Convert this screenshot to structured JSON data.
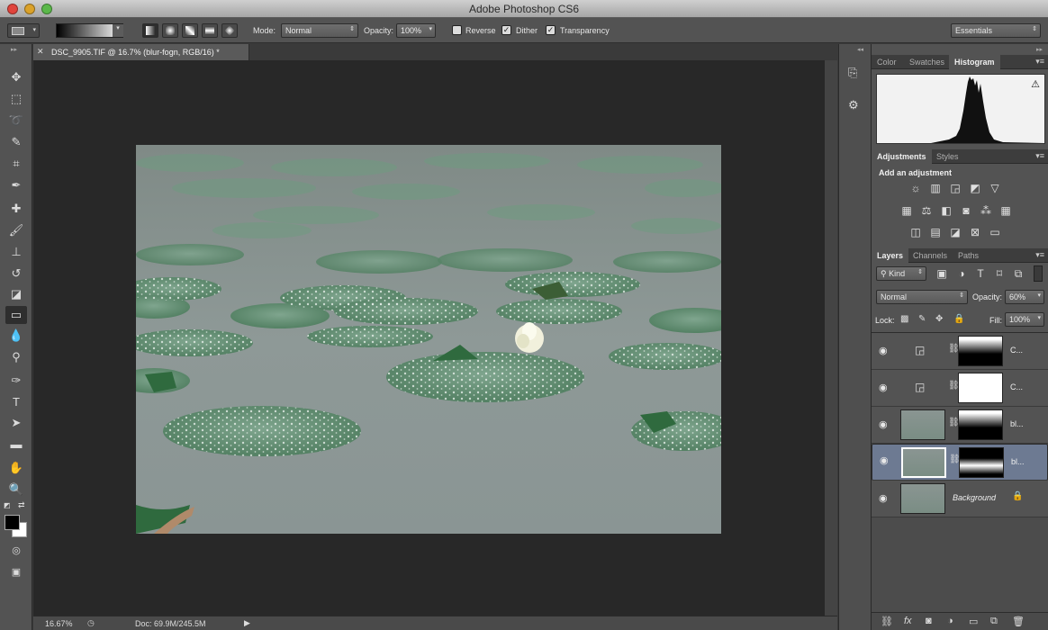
{
  "window": {
    "title": "Adobe Photoshop CS6"
  },
  "options_bar": {
    "mode_label": "Mode:",
    "mode_value": "Normal",
    "opacity_label": "Opacity:",
    "opacity_value": "100%",
    "reverse_label": "Reverse",
    "dither_label": "Dither",
    "transparency_label": "Transparency",
    "reverse_checked": false,
    "dither_checked": true,
    "transparency_checked": true,
    "workspace_value": "Essentials"
  },
  "document": {
    "tab_label": "DSC_9905.TIF @ 16.7% (blur-fogn, RGB/16) *",
    "zoom": "16.67%",
    "doc_size": "Doc: 69.9M/245.5M"
  },
  "top_panel": {
    "tabs": [
      "Color",
      "Swatches",
      "Histogram"
    ],
    "active_tab": "Histogram"
  },
  "adjustments_panel": {
    "tabs": [
      "Adjustments",
      "Styles"
    ],
    "active_tab": "Adjustments",
    "subtitle": "Add an adjustment"
  },
  "layers_panel": {
    "tabs": [
      "Layers",
      "Channels",
      "Paths"
    ],
    "active_tab": "Layers",
    "filter_kind": "Kind",
    "blend_mode": "Normal",
    "opacity_label": "Opacity:",
    "opacity_value": "60%",
    "lock_label": "Lock:",
    "fill_label": "Fill:",
    "fill_value": "100%",
    "layers": [
      {
        "name": "C...",
        "type": "adjustment",
        "mask": "gradient-top",
        "selected": false
      },
      {
        "name": "C...",
        "type": "adjustment",
        "mask": "white",
        "selected": false
      },
      {
        "name": "bl...",
        "type": "image",
        "mask": "gradient-top",
        "selected": false
      },
      {
        "name": "bl...",
        "type": "image",
        "mask": "gradient-band",
        "selected": true
      },
      {
        "name": "Background",
        "type": "background",
        "mask": "none",
        "selected": false
      }
    ]
  },
  "colors": {
    "ui_panel": "#535353",
    "canvas_bg": "#282828",
    "selected_layer": "#6d7a92"
  }
}
